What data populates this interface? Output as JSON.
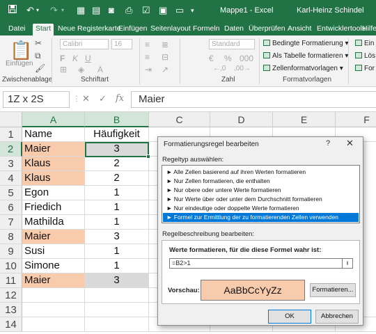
{
  "window": {
    "title": "Mappe1  -  Excel",
    "user": "Karl-Heinz Schindel"
  },
  "quick_access": {
    "save_icon": "save-icon",
    "undo_icon": "undo-icon",
    "redo_icon": "redo-icon"
  },
  "ribbon_tabs": [
    "Datei",
    "Start",
    "Neue Registerkarte",
    "Einfügen",
    "Seitenlayout",
    "Formeln",
    "Daten",
    "Überprüfen",
    "Ansicht",
    "Entwicklertools",
    "Hilfe"
  ],
  "ribbon": {
    "clipboard_label": "Zwischenablage",
    "paste_label": "Einfügen",
    "font_label": "Schriftart",
    "font_name": "Calibri",
    "font_size": "16",
    "number_label": "Zahl",
    "number_format": "Standard",
    "styles_label": "Formatvorlagen",
    "cond_format": "Bedingte Formatierung",
    "as_table": "Als Tabelle formatieren",
    "cell_styles": "Zellenformatvorlagen",
    "cells": [
      "Ein",
      "Lös",
      "For"
    ]
  },
  "formula_bar": {
    "name_box": "1Z x 2S",
    "content": "Maier"
  },
  "sheet": {
    "columns": [
      "A",
      "B",
      "C",
      "D",
      "E",
      "F"
    ],
    "rows": [
      "1",
      "2",
      "3",
      "4",
      "5",
      "6",
      "7",
      "8",
      "9",
      "10",
      "11",
      "12",
      "13",
      "14"
    ],
    "header": [
      "Name",
      "Häufigkeit"
    ],
    "data": [
      {
        "name": "Maier",
        "count": "3"
      },
      {
        "name": "Klaus",
        "count": "2"
      },
      {
        "name": "Klaus",
        "count": "2"
      },
      {
        "name": "Egon",
        "count": "1"
      },
      {
        "name": "Friedich",
        "count": "1"
      },
      {
        "name": "Mathilda",
        "count": "1"
      },
      {
        "name": "Maier",
        "count": "3"
      },
      {
        "name": "Susi",
        "count": "1"
      },
      {
        "name": "Simone",
        "count": "1"
      },
      {
        "name": "Maier",
        "count": "3"
      }
    ],
    "highlight_color": "#f8cbad",
    "accent_color": "#217346"
  },
  "dialog": {
    "title": "Formatierungsregel bearbeiten",
    "help": "?",
    "close": "✕",
    "ruletype_label": "Regeltyp auswählen:",
    "rule_types": [
      "► Alle Zellen basierend auf ihren Werten formatieren",
      "► Nur Zellen formatieren, die enthalten",
      "► Nur obere oder untere Werte formatieren",
      "► Nur Werte über oder unter dem Durchschnitt formatieren",
      "► Nur eindeutige oder doppelte Werte formatieren",
      "► Formel zur Ermittlung der zu formatierenden Zellen verwenden"
    ],
    "selected_rule": 5,
    "desc_label": "Regelbeschreibung bearbeiten:",
    "formula_label": "Werte formatieren, für die diese Formel wahr ist:",
    "formula": "=B2>1",
    "preview_label": "Vorschau:",
    "preview_text": "AaBbCcYyZz",
    "format_button": "Formatieren...",
    "ok_button": "OK",
    "cancel_button": "Abbrechen"
  }
}
